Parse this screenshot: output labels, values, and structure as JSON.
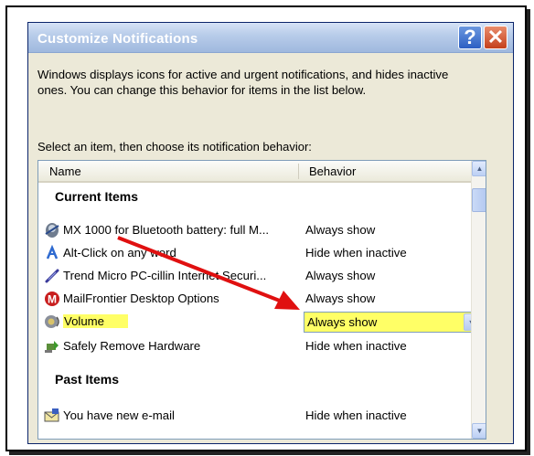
{
  "dialog": {
    "title": "Customize Notifications",
    "help_glyph": "?",
    "close_glyph": "✕",
    "description": "Windows displays icons for active and urgent notifications, and hides inactive ones. You can change this behavior for items in the list below.",
    "select_label": "Select an item, then choose its notification behavior:"
  },
  "list": {
    "columns": {
      "name": "Name",
      "behavior": "Behavior"
    },
    "groups": [
      {
        "title": "Current Items",
        "items": [
          {
            "icon": "mouse-icon",
            "name": "MX 1000 for Bluetooth battery: full M...",
            "behavior": "Always show"
          },
          {
            "icon": "alt-click-icon",
            "name": "Alt-Click on any word",
            "behavior": "Hide when inactive"
          },
          {
            "icon": "trend-micro-icon",
            "name": "Trend Micro PC-cillin Internet Securi...",
            "behavior": "Always show"
          },
          {
            "icon": "mailfrontier-icon",
            "name": "MailFrontier Desktop Options",
            "behavior": "Always show"
          },
          {
            "icon": "speaker-icon",
            "name": "Volume",
            "behavior": "Always show",
            "selected": true
          },
          {
            "icon": "safely-remove-icon",
            "name": "Safely Remove Hardware",
            "behavior": "Hide when inactive"
          }
        ]
      },
      {
        "title": "Past Items",
        "items": [
          {
            "icon": "email-icon",
            "name": "You have new e-mail",
            "behavior": "Hide when inactive"
          }
        ]
      }
    ]
  },
  "colors": {
    "highlight": "#ffff66",
    "arrow": "#e01010",
    "title_text": "#ffffff"
  }
}
